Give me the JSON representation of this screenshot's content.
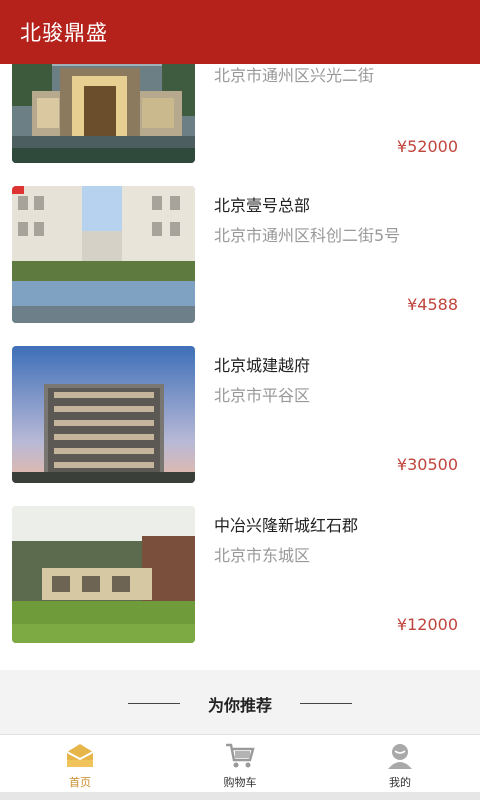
{
  "header": {
    "title": "北骏鼎盛"
  },
  "listings": [
    {
      "name": "",
      "address": "北京市通州区兴光二街",
      "price": "¥52000"
    },
    {
      "name": "北京壹号总部",
      "address": "北京市通州区科创二街5号",
      "price": "¥4588"
    },
    {
      "name": "北京城建越府",
      "address": "北京市平谷区",
      "price": "¥30500"
    },
    {
      "name": "中冶兴隆新城红石郡",
      "address": "北京市东城区",
      "price": "¥12000"
    }
  ],
  "recommend": {
    "label": "为你推荐"
  },
  "tabbar": {
    "tabs": [
      {
        "label": "首页",
        "icon": "home-icon",
        "active": true
      },
      {
        "label": "购物车",
        "icon": "cart-icon",
        "active": false
      },
      {
        "label": "我的",
        "icon": "profile-icon",
        "active": false
      }
    ],
    "active_color": "#c98d2a"
  },
  "colors": {
    "brand": "#b5221b",
    "price": "#c0453c"
  }
}
